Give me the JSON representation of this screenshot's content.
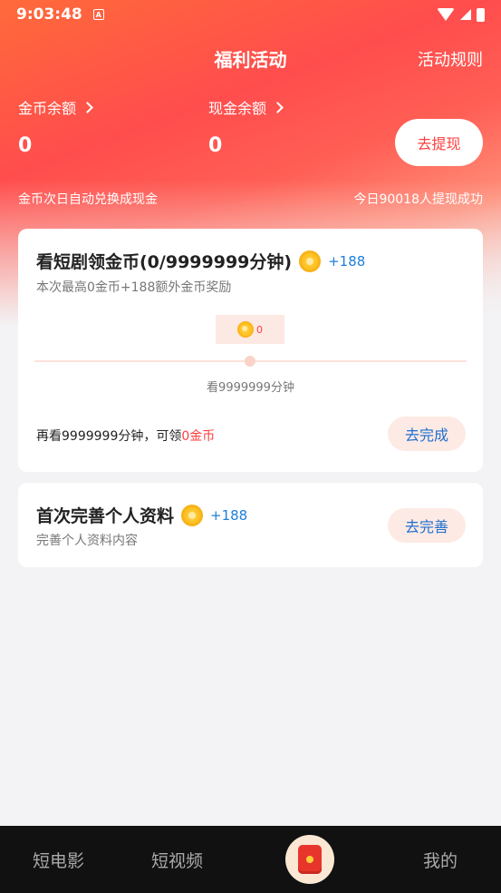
{
  "status_bar": {
    "time": "9:03:48",
    "notification_glyph": "A"
  },
  "header": {
    "title": "福利活动",
    "rules_link": "活动规则"
  },
  "balances": {
    "coin_label": "金币余额",
    "coin_value": "0",
    "cash_label": "现金余额",
    "cash_value": "0",
    "withdraw_button": "去提现",
    "exchange_note": "金币次日自动兑换成现金",
    "withdraw_stats": "今日90018人提现成功"
  },
  "tasks": [
    {
      "title": "看短剧领金币(0/9999999分钟)",
      "bonus": "+188",
      "subtitle": "本次最高0金币+188额外金币奖励",
      "tip_value": "0",
      "milestone_label": "看9999999分钟",
      "remaining_prefix": "再看9999999分钟，可领",
      "remaining_reward": "0金币",
      "action": "去完成"
    },
    {
      "title": "首次完善个人资料",
      "bonus": "+188",
      "subtitle": "完善个人资料内容",
      "action": "去完善"
    }
  ],
  "tabbar": {
    "tab1": "短电影",
    "tab2": "短视频",
    "center_icon": "red-envelope-icon",
    "tab4": "我的"
  },
  "colors": {
    "accent": "#ff4d4d",
    "link_blue": "#1f7fd8",
    "coin": "#ffbf1f"
  }
}
